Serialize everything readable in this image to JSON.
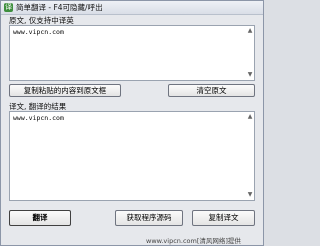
{
  "window": {
    "title": "简单翻译 - F4可隐藏/呼出"
  },
  "source": {
    "label": "原文, 仅支持中译英",
    "text": "www.vipcn.com",
    "paste_button": "复制粘贴的内容到原文框",
    "clear_button": "清空原文"
  },
  "result": {
    "label": "译文, 翻译的结果",
    "text": "www.vipcn.com"
  },
  "actions": {
    "translate_button": "翻译",
    "get_source_button": "获取程序源码",
    "copy_result_button": "复制译文"
  },
  "watermark": "www.vipcn.com[清风网络]提供"
}
